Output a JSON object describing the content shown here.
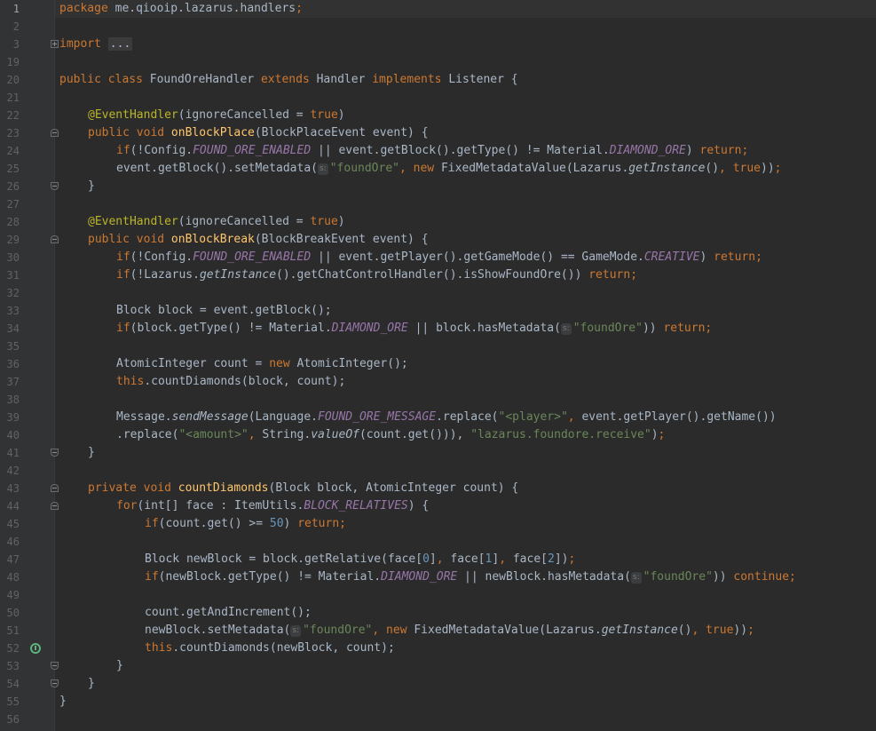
{
  "line_numbers": [
    "1",
    "2",
    "3",
    "19",
    "20",
    "21",
    "22",
    "23",
    "24",
    "25",
    "26",
    "27",
    "28",
    "29",
    "30",
    "31",
    "32",
    "33",
    "34",
    "35",
    "36",
    "37",
    "38",
    "39",
    "40",
    "41",
    "42",
    "43",
    "44",
    "45",
    "46",
    "47",
    "48",
    "49",
    "50",
    "51",
    "52",
    "53",
    "54",
    "55",
    "56"
  ],
  "hint_label": "s:",
  "gutter_icons": {
    "fold": "fold-marker-icon",
    "recursive_call": "recursive-call-icon"
  },
  "colors": {
    "background": "#2b2b2b",
    "gutter": "#313335",
    "text": "#a9b7c6",
    "keyword": "#cc7832",
    "string": "#6a8759",
    "number": "#6897bb",
    "annotation": "#bbb529",
    "method_decl": "#ffc66d",
    "static_field": "#9876aa"
  },
  "code": {
    "package_name": "me.qiooip.lazarus.handlers",
    "import_fold": "...",
    "class_name": "FoundOreHandler",
    "parent_class": "Handler",
    "interface_name": "Listener",
    "event_handler": "@EventHandler",
    "ignore_cancelled": "ignoreCancelled",
    "method_place": "onBlockPlace",
    "method_break": "onBlockBreak",
    "method_count": "countDiamonds",
    "block_place_event": "BlockPlaceEvent",
    "block_break_event": "BlockBreakEvent",
    "config_class": "Config.",
    "found_ore_enabled": "FOUND_ORE_ENABLED",
    "material_class": "Material.",
    "diamond_ore": "DIAMOND_ORE",
    "creative": "CREATIVE",
    "found_ore_message": "FOUND_ORE_MESSAGE",
    "block_relatives": "BLOCK_RELATIVES",
    "metadata_key": "\"foundOre\"",
    "player_placeholder": "\"<player>\"",
    "amount_placeholder": "\"<amount>\"",
    "permission": "\"lazarus.foundore.receive\"",
    "get_instance": "getInstance",
    "send_message": "sendMessage",
    "value_of": "valueOf",
    "limit_value": "50",
    "idx0": "0",
    "idx1": "1",
    "idx2": "2",
    "l24_a": "event.getBlock().getType() != ",
    "l25_a": "event.getBlock().setMetadata(",
    "l25_b": "FixedMetadataValue(Lazarus.",
    "l30_a": "event.getPlayer().getGameMode() == GameMode.",
    "l31_a": "(!Lazarus.",
    "l31_b": "().getChatControlHandler().isShowFoundOre()) ",
    "l33": "Block block = event.getBlock();",
    "l34_a": "(block.getType() != ",
    "l34_b": "block.hasMetadata(",
    "l36_a": "AtomicInteger count = ",
    "l36_b": "AtomicInteger();",
    "l37_a": ".countDiamonds(block, count);",
    "l39_a": "Message.",
    "l39_b": "(Language.",
    "l39_c": ".replace(",
    "l39_d": "event.getPlayer().getName())",
    "l40_a": ".replace(",
    "l40_b": "String.",
    "l40_c": "(count.get())), ",
    "l43_params": "(Block block, AtomicInteger count) {",
    "l44_a": "(int[] face : ItemUtils.",
    "l45_a": "(count.get() >= ",
    "l47_a": "Block newBlock = block.getRelative(face[",
    "l48_a": "(newBlock.getType() != ",
    "l48_b": "newBlock.hasMetadata(",
    "l50": "count.getAndIncrement();",
    "l51_a": "newBlock.setMetadata(",
    "l52_a": ".countDiamonds(newBlock, count);"
  }
}
